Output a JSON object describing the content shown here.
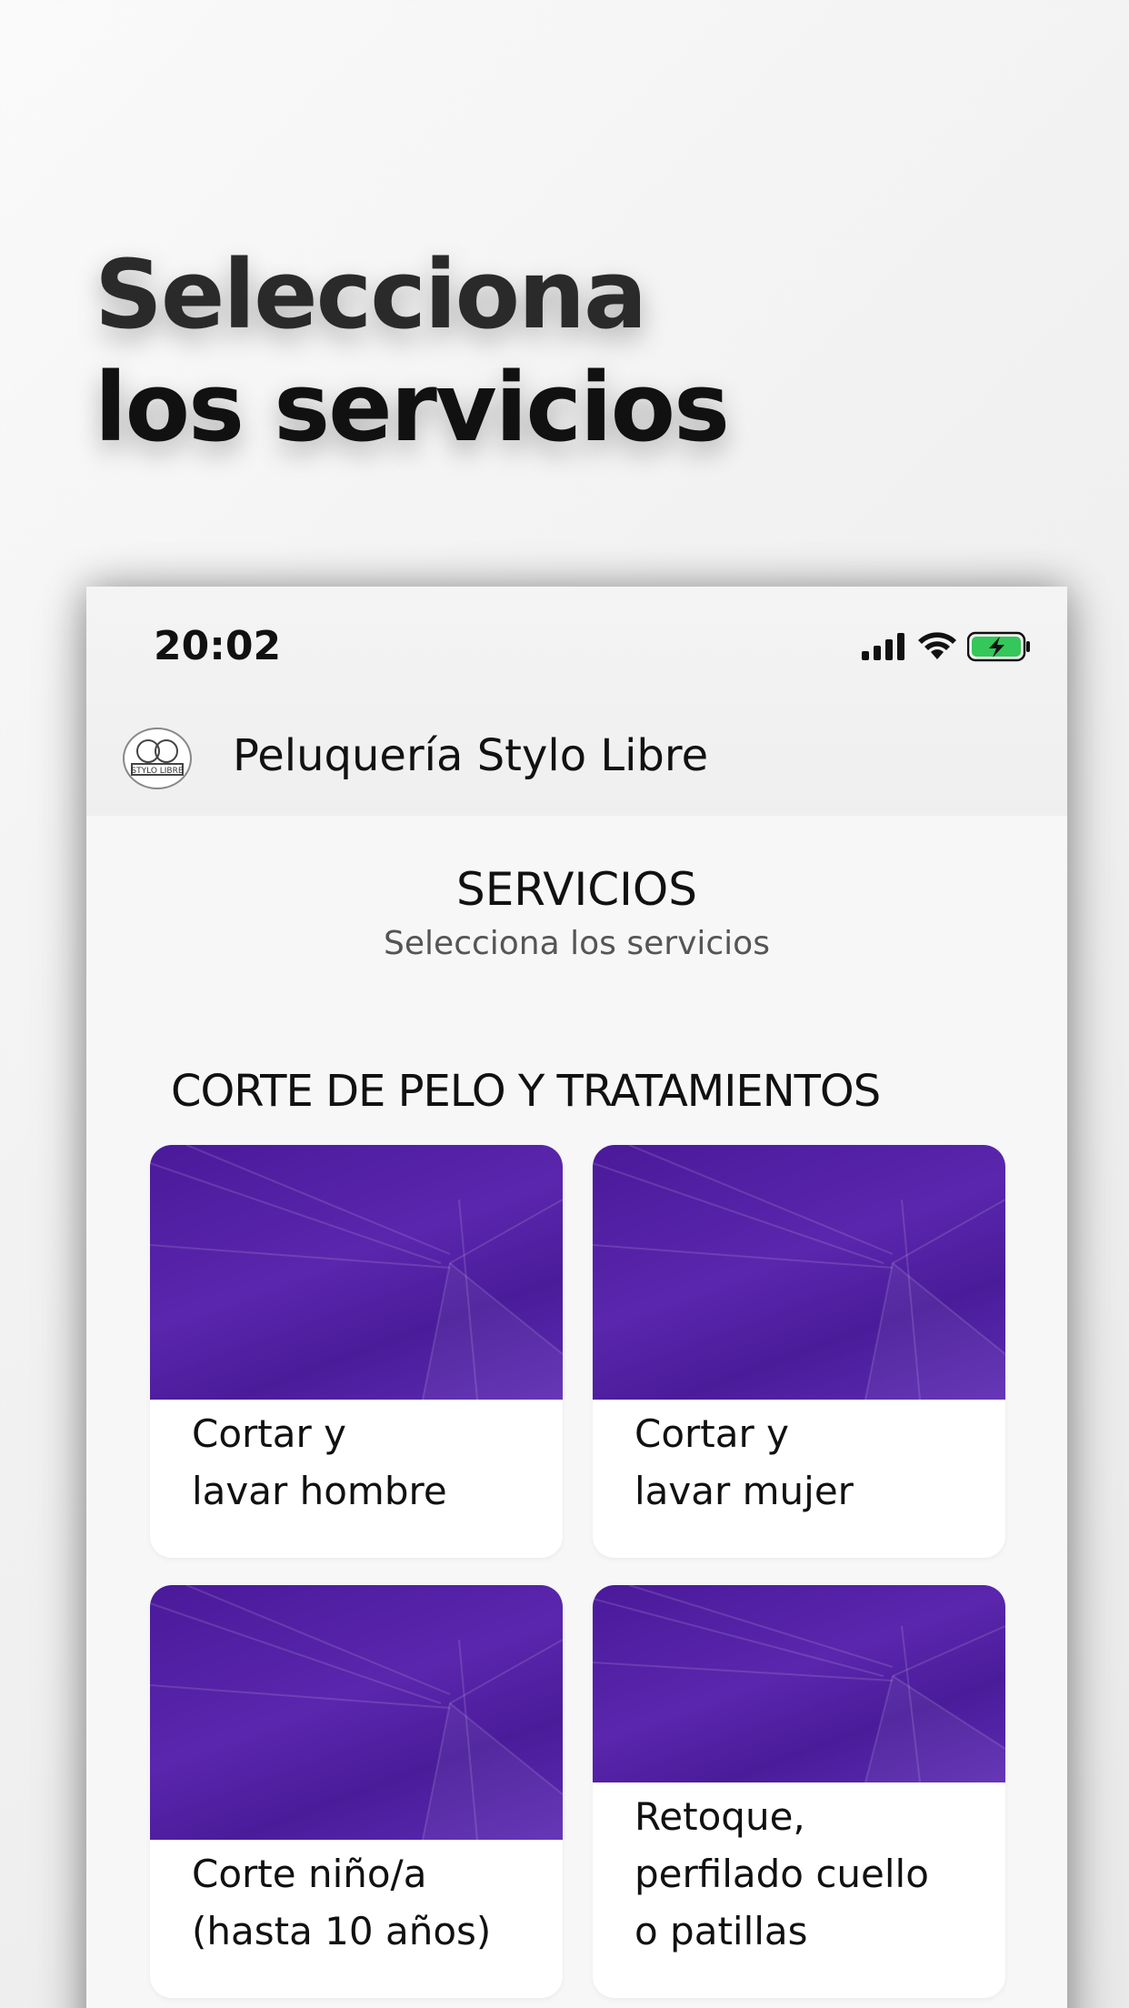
{
  "hero": {
    "line1": "Selecciona",
    "line2": "los servicios"
  },
  "status_bar": {
    "time": "20:02",
    "icons": [
      "signal-icon",
      "wifi-icon",
      "battery-charging-icon"
    ],
    "battery_color": "#34c759"
  },
  "app_bar": {
    "title": "Peluquería Stylo Libre",
    "logo": "stylo-libre-logo"
  },
  "page": {
    "title": "SERVICIOS",
    "subtitle": "Selecciona los servicios"
  },
  "category": {
    "title": "CORTE DE PELO Y TRATAMIENTOS"
  },
  "services": [
    {
      "line1": "Cortar y",
      "line2": "lavar hombre",
      "line3": ""
    },
    {
      "line1": "Cortar y",
      "line2": "lavar mujer",
      "line3": ""
    },
    {
      "line1": "Corte niño/a",
      "line2": "(hasta 10 años)",
      "line3": ""
    },
    {
      "line1": "Retoque,",
      "line2": "perfilado cuello",
      "line3": "o patillas"
    }
  ],
  "colors": {
    "card_image": "#4f1fa0",
    "text": "#111111",
    "subtitle": "#555555"
  }
}
